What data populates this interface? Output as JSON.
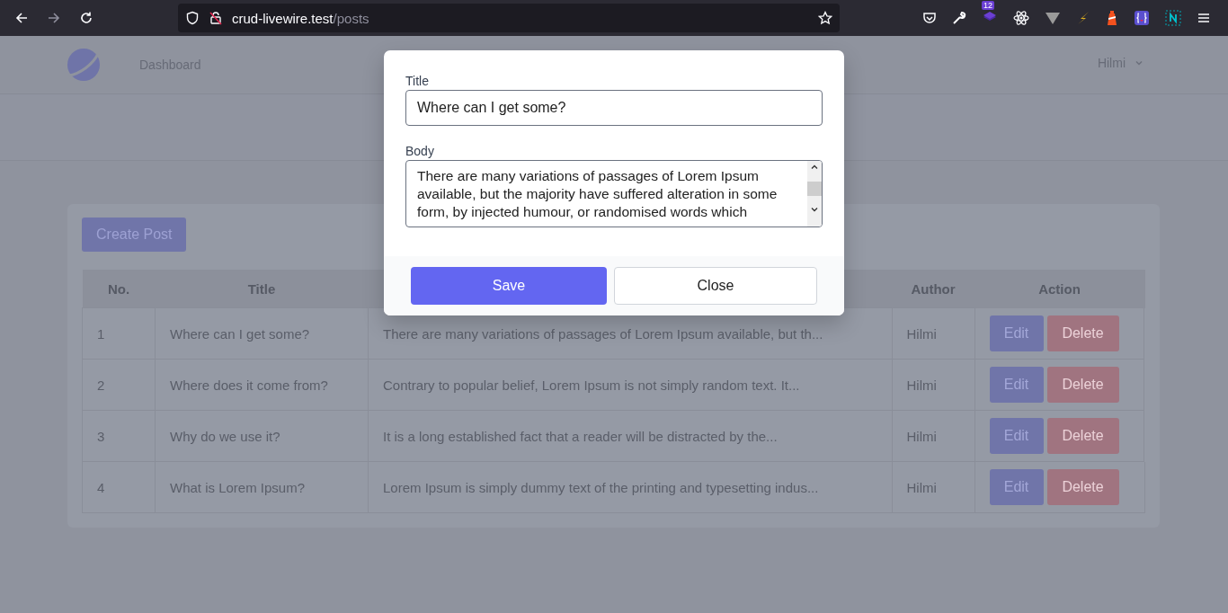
{
  "browser": {
    "url_host": "crud-livewire.test",
    "url_path": "/posts",
    "extension_badge": "12"
  },
  "nav": {
    "link": "Dashboard",
    "user": "Hilmi"
  },
  "create_button": "Create Post",
  "table": {
    "columns": [
      "No.",
      "Title",
      "Author",
      "Action"
    ],
    "rows": [
      {
        "no": "1",
        "title": "Where can I get some?",
        "body": "There are many variations of passages of Lorem Ipsum available, but th...",
        "author": "Hilmi",
        "edit": "Edit",
        "delete": "Delete"
      },
      {
        "no": "2",
        "title": "Where does it come from?",
        "body": "Contrary to popular belief, Lorem Ipsum is not simply random text. It...",
        "author": "Hilmi",
        "edit": "Edit",
        "delete": "Delete"
      },
      {
        "no": "3",
        "title": "Why do we use it?",
        "body": "It is a long established fact that a reader will be distracted by the...",
        "author": "Hilmi",
        "edit": "Edit",
        "delete": "Delete"
      },
      {
        "no": "4",
        "title": "What is Lorem Ipsum?",
        "body": "Lorem Ipsum is simply dummy text of the printing and typesetting indus...",
        "author": "Hilmi",
        "edit": "Edit",
        "delete": "Delete"
      }
    ]
  },
  "modal": {
    "title_label": "Title",
    "title_value": "Where can I get some?",
    "body_label": "Body",
    "body_value": "There are many variations of passages of Lorem Ipsum available, but the majority have suffered alteration in some form, by injected humour, or randomised words which",
    "save": "Save",
    "close": "Close"
  }
}
